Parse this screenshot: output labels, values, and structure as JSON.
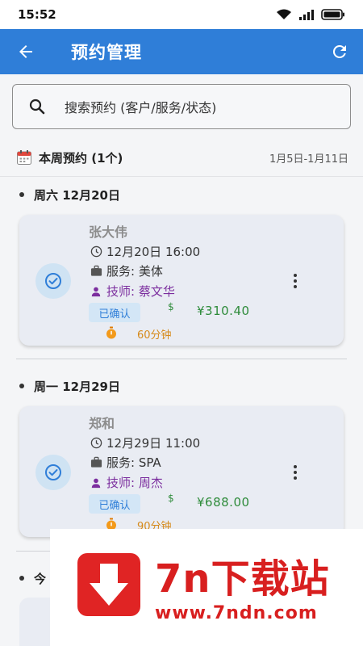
{
  "status_bar": {
    "time": "15:52"
  },
  "app_bar": {
    "title": "预约管理"
  },
  "search": {
    "placeholder": "搜索预约 (客户/服务/状态)"
  },
  "week": {
    "title": "本周预约 (1个)",
    "range": "1月5日-1月11日"
  },
  "days": [
    {
      "label": "周六 12月20日",
      "appointment": {
        "customer": "张大伟",
        "datetime": "12月20日 16:00",
        "service": "服务: 美体",
        "technician": "技师: 蔡文华",
        "status": "已确认",
        "currency_symbol": "$",
        "price": "¥310.40",
        "duration": "60分钟"
      }
    },
    {
      "label": "周一 12月29日",
      "appointment": {
        "customer": "郑和",
        "datetime": "12月29日 11:00",
        "service": "服务: SPA",
        "technician": "技师: 周杰",
        "status": "已确认",
        "currency_symbol": "$",
        "price": "¥688.00",
        "duration": "90分钟"
      }
    },
    {
      "label": "今"
    }
  ],
  "watermark": {
    "brand": "7n下载站",
    "url": "www.7ndn.com"
  },
  "colors": {
    "primary": "#2f7ed8",
    "price": "#2e8b3a",
    "technician": "#7b2d9e",
    "duration": "#d68a1a",
    "watermark": "#d81f1f"
  },
  "icons": [
    "back-arrow-icon",
    "refresh-icon",
    "search-icon",
    "calendar-icon",
    "check-circle-icon",
    "clock-icon",
    "briefcase-icon",
    "person-icon",
    "timer-icon",
    "more-vert-icon",
    "download-icon"
  ]
}
